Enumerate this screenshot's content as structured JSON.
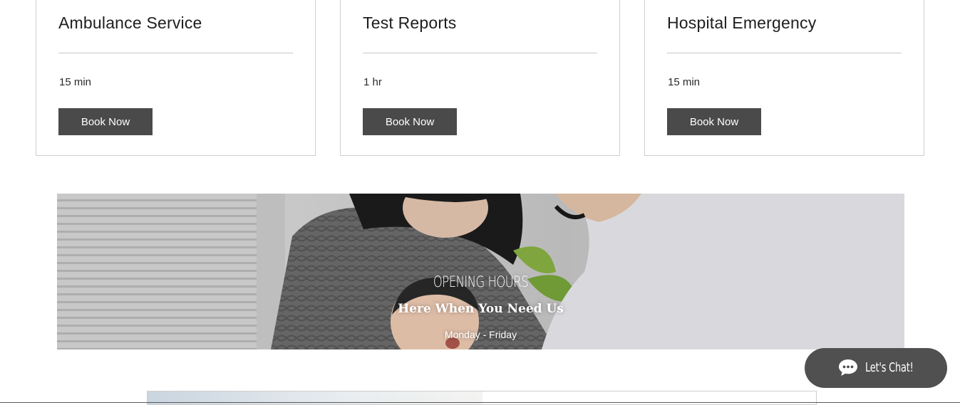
{
  "services": [
    {
      "title": "Ambulance Service",
      "duration": "15 min",
      "button": "Book Now"
    },
    {
      "title": "Test Reports",
      "duration": "1 hr",
      "button": "Book Now"
    },
    {
      "title": "Hospital Emergency",
      "duration": "15 min",
      "button": "Book Now"
    }
  ],
  "hero": {
    "title": "OPENING HOURS",
    "subtitle": "Here When You Need Us",
    "days": "Monday - Friday"
  },
  "chat": {
    "label": "Let's Chat!",
    "icon": "chat-bubble-icon"
  },
  "colors": {
    "button_bg": "#4a4a4a",
    "chat_bg": "#505050",
    "card_border": "#cfcfcf"
  }
}
